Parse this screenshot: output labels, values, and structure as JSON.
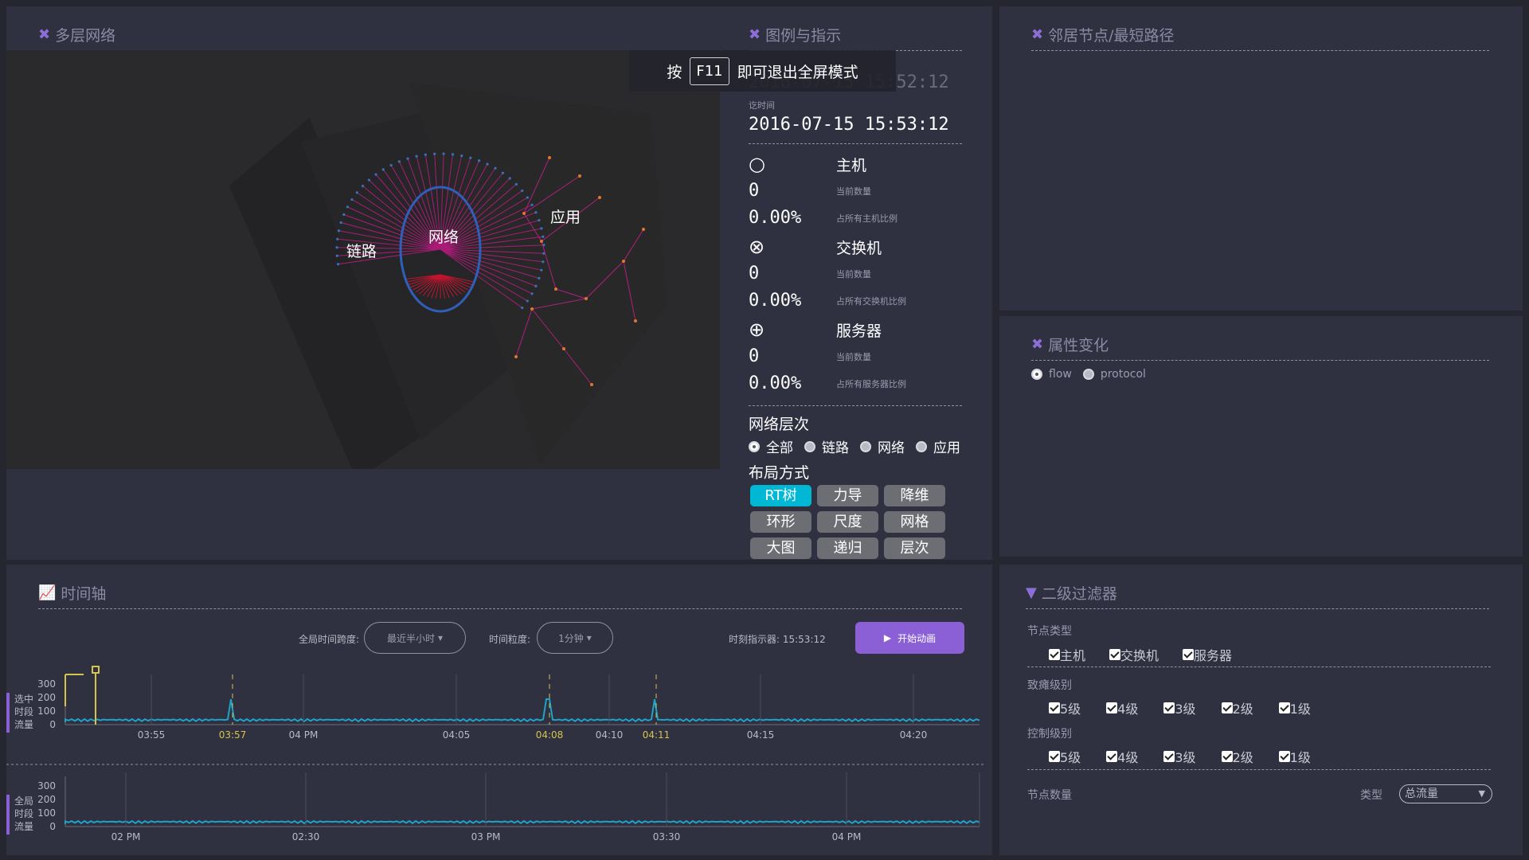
{
  "panels": {
    "network": {
      "title": "多层网络"
    },
    "legend": {
      "title": "图例与指示"
    },
    "neighbors": {
      "title": "邻居节点/最短路径"
    },
    "attr": {
      "title": "属性变化"
    },
    "timeline": {
      "title": "时间轴"
    },
    "filter": {
      "title": "二级过滤器"
    }
  },
  "network_layers": {
    "link": "链路",
    "network": "网络",
    "app": "应用"
  },
  "f11_notice": {
    "prefix": "按",
    "key": "F11",
    "suffix": "即可退出全屏模式"
  },
  "legend": {
    "start_time": "2016-07-15 15:52:12",
    "end_label": "讫时间",
    "end_time": "2016-07-15 15:53:12",
    "items": [
      {
        "name": "主机",
        "count": "0",
        "count_label": "当前数量",
        "ratio": "0.00%",
        "ratio_label": "占所有主机比例"
      },
      {
        "name": "交换机",
        "count": "0",
        "count_label": "当前数量",
        "ratio": "0.00%",
        "ratio_label": "占所有交换机比例"
      },
      {
        "name": "服务器",
        "count": "0",
        "count_label": "当前数量",
        "ratio": "0.00%",
        "ratio_label": "占所有服务器比例"
      }
    ],
    "layer_title": "网络层次",
    "layer_options": [
      "全部",
      "链路",
      "网络",
      "应用"
    ],
    "layout_title": "布局方式",
    "layout_buttons": [
      "RT树",
      "力导",
      "降维",
      "环形",
      "尺度",
      "网格",
      "大图",
      "递归",
      "层次"
    ],
    "active_layout": "RT树"
  },
  "attr_options": [
    "flow",
    "protocol"
  ],
  "timeline": {
    "span_label": "全局时间跨度:",
    "span_value": "最近半小时",
    "gran_label": "时间粒度:",
    "gran_value": "1分钟",
    "indicator": "时刻指示器: 15:53:12",
    "play_label": "开始动画",
    "selected_label": [
      "选中",
      "时段",
      "流量"
    ],
    "global_label": [
      "全局",
      "时段",
      "流量"
    ],
    "y_ticks": [
      "300",
      "200",
      "100",
      "0"
    ],
    "top_ticks": [
      {
        "t": "03:55",
        "hl": false
      },
      {
        "t": "03:57",
        "hl": true
      },
      {
        "t": "04 PM",
        "hl": false
      },
      {
        "t": "04:05",
        "hl": false
      },
      {
        "t": "04:08",
        "hl": true
      },
      {
        "t": "04:10",
        "hl": false
      },
      {
        "t": "04:11",
        "hl": true
      },
      {
        "t": "04:15",
        "hl": false
      },
      {
        "t": "04:20",
        "hl": false
      }
    ],
    "bottom_ticks": [
      "02 PM",
      "02:30",
      "03 PM",
      "03:30",
      "04 PM"
    ]
  },
  "filter": {
    "node_type_label": "节点类型",
    "node_types": [
      "主机",
      "交换机",
      "服务器"
    ],
    "danger_label": "致瘫级别",
    "levels": [
      "5级",
      "4级",
      "3级",
      "2级",
      "1级"
    ],
    "control_label": "控制级别",
    "node_count_label": "节点数量",
    "type_label": "类型",
    "type_value": "总流量"
  },
  "colors": {
    "accent": "#00b8d4",
    "purple": "#8b5fd6",
    "series": "#1fa3c9",
    "highlight": "#d6c34f"
  }
}
